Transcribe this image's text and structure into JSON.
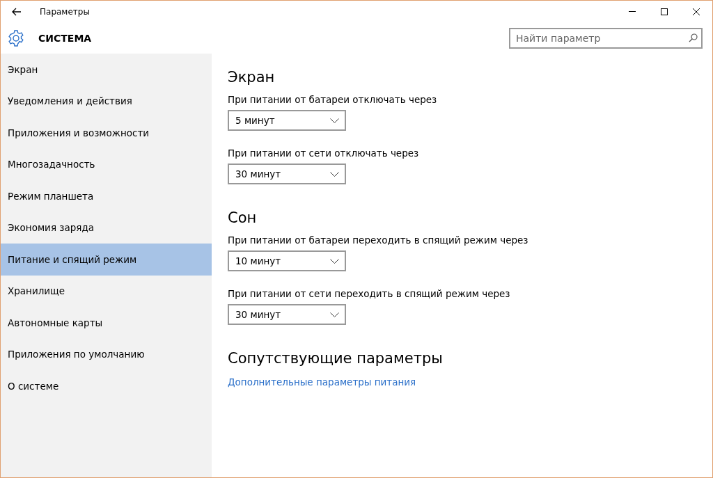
{
  "window": {
    "title": "Параметры"
  },
  "header": {
    "title": "СИСТЕМА",
    "search": {
      "placeholder": "Найти параметр"
    }
  },
  "sidebar": {
    "items": [
      {
        "label": "Экран",
        "selected": false
      },
      {
        "label": "Уведомления и действия",
        "selected": false
      },
      {
        "label": "Приложения и возможности",
        "selected": false
      },
      {
        "label": "Многозадачность",
        "selected": false
      },
      {
        "label": "Режим планшета",
        "selected": false
      },
      {
        "label": "Экономия заряда",
        "selected": false
      },
      {
        "label": "Питание и спящий режим",
        "selected": true
      },
      {
        "label": "Хранилище",
        "selected": false
      },
      {
        "label": "Автономные карты",
        "selected": false
      },
      {
        "label": "Приложения по умолчанию",
        "selected": false
      },
      {
        "label": "О системе",
        "selected": false
      }
    ]
  },
  "sections": [
    {
      "title": "Экран",
      "settings": [
        {
          "label": "При питании от батареи отключать через",
          "value": "5 минут"
        },
        {
          "label": "При питании от сети отключать через",
          "value": "30 минут"
        }
      ]
    },
    {
      "title": "Сон",
      "settings": [
        {
          "label": "При питании от батареи переходить в спящий режим через",
          "value": "10 минут"
        },
        {
          "label": "При питании от сети переходить в спящий режим через",
          "value": "30 минут"
        }
      ]
    }
  ],
  "related": {
    "title": "Сопутствующие параметры",
    "links": [
      "Дополнительные параметры питания"
    ]
  }
}
